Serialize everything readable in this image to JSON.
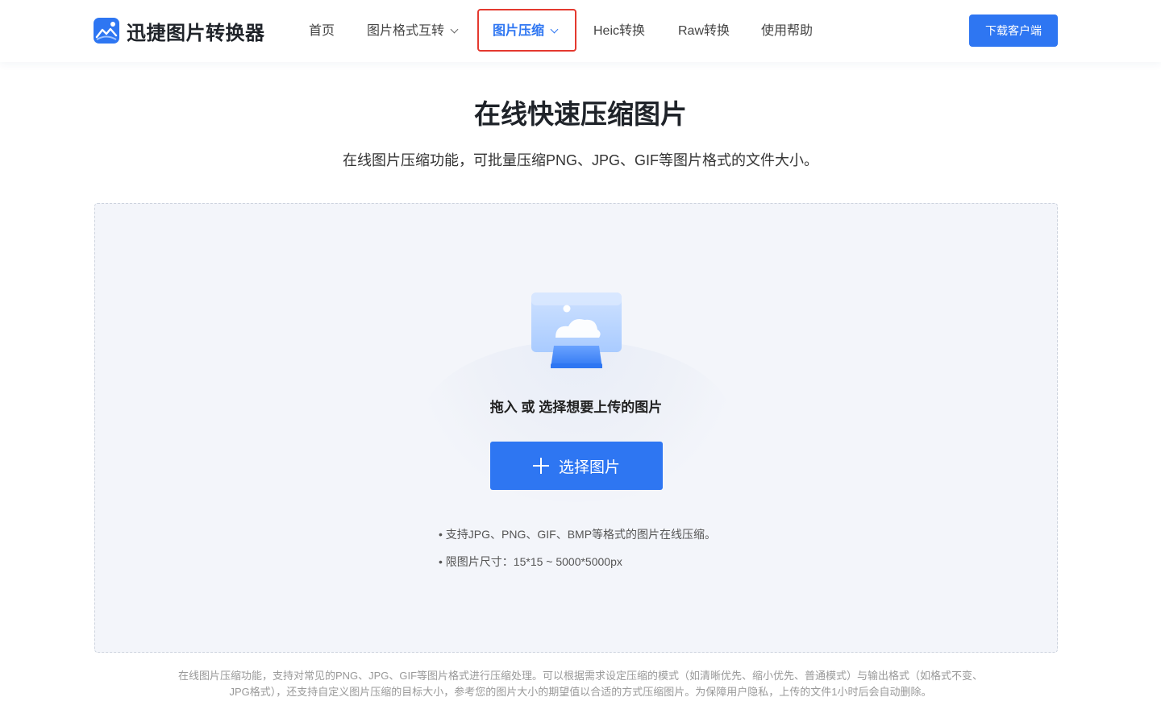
{
  "header": {
    "logo_text": "迅捷图片转换器",
    "nav": [
      {
        "label": "首页",
        "dropdown": false,
        "active": false
      },
      {
        "label": "图片格式互转",
        "dropdown": true,
        "active": false
      },
      {
        "label": "图片压缩",
        "dropdown": true,
        "active": true
      },
      {
        "label": "Heic转换",
        "dropdown": false,
        "active": false
      },
      {
        "label": "Raw转换",
        "dropdown": false,
        "active": false
      },
      {
        "label": "使用帮助",
        "dropdown": false,
        "active": false
      }
    ],
    "download_label": "下载客户端"
  },
  "hero": {
    "title": "在线快速压缩图片",
    "subtitle": "在线图片压缩功能，可批量压缩PNG、JPG、GIF等图片格式的文件大小。"
  },
  "upload": {
    "prompt": "拖入 或 选择想要上传的图片",
    "button_label": "选择图片",
    "tips": [
      "支持JPG、PNG、GIF、BMP等格式的图片在线压缩。",
      "限图片尺寸：15*15 ~ 5000*5000px"
    ]
  },
  "footer": {
    "line1": "在线图片压缩功能，支持对常见的PNG、JPG、GIF等图片格式进行压缩处理。可以根据需求设定压缩的模式（如清晰优先、缩小优先、普通模式）与输出格式（如格式不变、",
    "line2": "JPG格式），还支持自定义图片压缩的目标大小，参考您的图片大小的期望值以合适的方式压缩图片。为保障用户隐私，上传的文件1小时后会自动删除。"
  },
  "colors": {
    "accent": "#2e76f2",
    "highlight_frame": "#e4392f",
    "dropzone_bg": "#f3f5fa"
  },
  "icons": {
    "logo": "image-mountain-icon",
    "upload_illustration": "monitor-image-icon",
    "button": "plus-icon"
  }
}
